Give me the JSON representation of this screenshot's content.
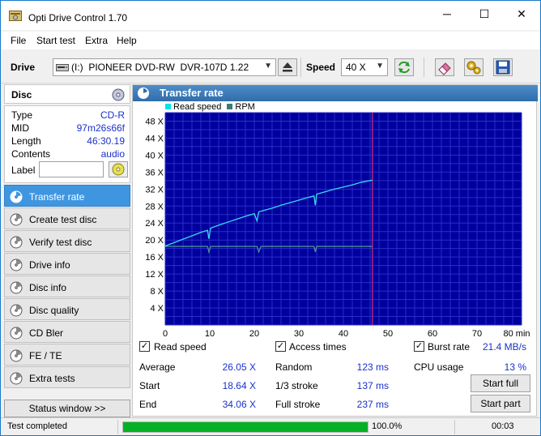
{
  "window": {
    "title": "Opti Drive Control 1.70",
    "minimize": "─",
    "maximize": "☐",
    "close": "✕"
  },
  "menu": [
    "File",
    "Start test",
    "Extra",
    "Help"
  ],
  "toolbar": {
    "drive_label": "Drive",
    "drive_value": "(I:)  PIONEER DVD-RW  DVR-107D 1.22",
    "speed_label": "Speed",
    "speed_value": "40 X"
  },
  "disc": {
    "header": "Disc",
    "rows": [
      {
        "k": "Type",
        "v": "CD-R"
      },
      {
        "k": "MID",
        "v": "97m26s66f"
      },
      {
        "k": "Length",
        "v": "46:30.19"
      },
      {
        "k": "Contents",
        "v": "audio"
      }
    ],
    "label_key": "Label",
    "label_value": ""
  },
  "nav": [
    {
      "label": "Transfer rate",
      "active": true
    },
    {
      "label": "Create test disc",
      "active": false
    },
    {
      "label": "Verify test disc",
      "active": false
    },
    {
      "label": "Drive info",
      "active": false
    },
    {
      "label": "Disc info",
      "active": false
    },
    {
      "label": "Disc quality",
      "active": false
    },
    {
      "label": "CD Bler",
      "active": false
    },
    {
      "label": "FE / TE",
      "active": false
    },
    {
      "label": "Extra tests",
      "active": false
    }
  ],
  "status_window_button": "Status window >>",
  "panel": {
    "title": "Transfer rate"
  },
  "chart_data": {
    "type": "line",
    "legend": [
      {
        "name": "Read speed",
        "color": "#00e5e5"
      },
      {
        "name": "RPM",
        "color": "#3a7a7a"
      }
    ],
    "x_ticks": [
      "0",
      "10",
      "20",
      "30",
      "40",
      "50",
      "60",
      "70",
      "80 min"
    ],
    "y_ticks": [
      "4 X",
      "8 X",
      "12 X",
      "16 X",
      "20 X",
      "24 X",
      "28 X",
      "32 X",
      "36 X",
      "40 X",
      "44 X",
      "48 X"
    ],
    "xlim": [
      0,
      80
    ],
    "ylim": [
      0,
      50
    ],
    "marker_x": 46.5,
    "series": [
      {
        "name": "Read speed",
        "color": "#38d8ee",
        "x": [
          0,
          2,
          4,
          6,
          8,
          9.5,
          9.8,
          10.2,
          12,
          14,
          16,
          18,
          20,
          20.6,
          21,
          21.5,
          24,
          26,
          28,
          30,
          32,
          33.4,
          33.7,
          34,
          36,
          38,
          40,
          42,
          44,
          46.5
        ],
        "y": [
          18.6,
          19.4,
          20.2,
          21.0,
          21.8,
          22.3,
          20.3,
          22.8,
          23.5,
          24.2,
          24.9,
          25.6,
          26.2,
          24.5,
          26.6,
          26.8,
          27.5,
          28.2,
          28.8,
          29.4,
          30.0,
          30.4,
          28.2,
          30.8,
          31.4,
          32.0,
          32.5,
          33.0,
          33.6,
          34.1
        ]
      },
      {
        "name": "RPM",
        "color": "#4e8f8f",
        "x": [
          0,
          9.5,
          9.8,
          10.2,
          20.6,
          21,
          21.5,
          33.4,
          33.7,
          34,
          46.5
        ],
        "y": [
          18.5,
          18.5,
          17.2,
          18.5,
          18.5,
          17.2,
          18.5,
          18.5,
          17.2,
          18.5,
          18.5
        ]
      }
    ]
  },
  "stats": {
    "read_speed_label": "Read speed",
    "access_times_label": "Access times",
    "burst_rate_label": "Burst rate",
    "burst_rate_value": "21.4 MB/s",
    "average_label": "Average",
    "average_value": "26.05 X",
    "start_label": "Start",
    "start_value": "18.64 X",
    "end_label": "End",
    "end_value": "34.06 X",
    "random_label": "Random",
    "random_value": "123 ms",
    "third_label": "1/3 stroke",
    "third_value": "137 ms",
    "full_label": "Full stroke",
    "full_value": "237 ms",
    "cpu_label": "CPU usage",
    "cpu_value": "13 %",
    "start_full_button": "Start full",
    "start_part_button": "Start part"
  },
  "status": {
    "text": "Test completed",
    "progress": 1.0,
    "percent": "100.0%",
    "time": "00:03"
  }
}
